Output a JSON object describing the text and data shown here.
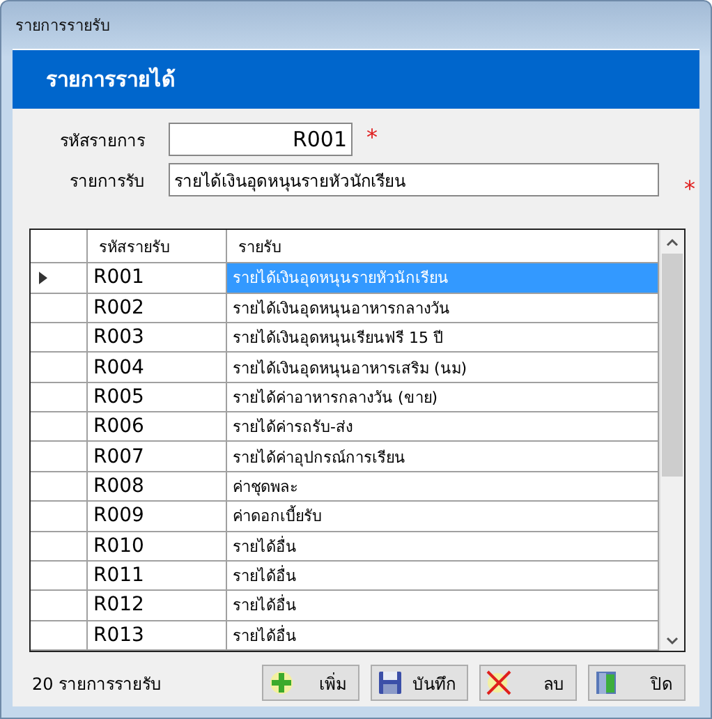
{
  "window": {
    "title": "รายการรายรับ"
  },
  "header": {
    "title": "รายการรายได้"
  },
  "form": [
    {
      "label": "รหัสรายการ",
      "value": "R001",
      "kind": "code",
      "required_mark": "*"
    },
    {
      "label": "รายการรับ",
      "value": "รายได้เงินอุดหนุนรายหัวนักเรียน",
      "kind": "text",
      "required_mark": "*"
    }
  ],
  "table": {
    "columns": [
      "รหัสรายรับ",
      "รายรับ"
    ],
    "rows": [
      {
        "code": "R001",
        "name": "รายได้เงินอุดหนุนรายหัวนักเรียน",
        "selected": true
      },
      {
        "code": "R002",
        "name": "รายได้เงินอุดหนุนอาหารกลางวัน",
        "selected": false
      },
      {
        "code": "R003",
        "name": "รายได้เงินอุดหนุนเรียนฟรี 15 ปี",
        "selected": false
      },
      {
        "code": "R004",
        "name": "รายได้เงินอุดหนุนอาหารเสริม (นม)",
        "selected": false
      },
      {
        "code": "R005",
        "name": "รายได้ค่าอาหารกลางวัน (ขาย)",
        "selected": false
      },
      {
        "code": "R006",
        "name": "รายได้ค่ารถรับ-ส่ง",
        "selected": false
      },
      {
        "code": "R007",
        "name": "รายได้ค่าอุปกรณ์การเรียน",
        "selected": false
      },
      {
        "code": "R008",
        "name": "ค่าชุดพละ",
        "selected": false
      },
      {
        "code": "R009",
        "name": "ค่าดอกเบี้ยรับ",
        "selected": false
      },
      {
        "code": "R010",
        "name": "รายได้อื่น",
        "selected": false
      },
      {
        "code": "R011",
        "name": "รายได้อื่น",
        "selected": false
      },
      {
        "code": "R012",
        "name": "รายได้อื่น",
        "selected": false
      },
      {
        "code": "R013",
        "name": "รายได้อื่น",
        "selected": false
      }
    ]
  },
  "status": {
    "count": "20 รายการรายรับ"
  },
  "buttons": [
    {
      "label": "เพิ่ม",
      "kind": "add"
    },
    {
      "label": "บันทึก",
      "kind": "save"
    },
    {
      "label": "ลบ",
      "kind": "delete"
    },
    {
      "label": "ปิด",
      "kind": "close"
    }
  ]
}
